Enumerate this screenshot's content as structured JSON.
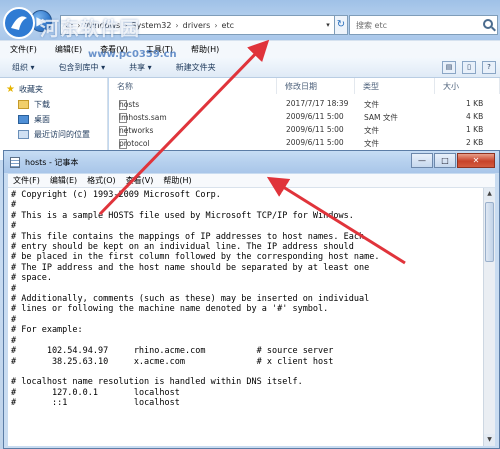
{
  "explorer": {
    "address": {
      "crumbs": [
        "C:",
        "Windows",
        "System32",
        "drivers",
        "etc"
      ],
      "dropdown_glyph": "▾",
      "refresh_glyph": "↻"
    },
    "search": {
      "placeholder": "搜索 etc"
    },
    "menu": [
      "文件(F)",
      "编辑(E)",
      "查看(V)",
      "工具(T)",
      "帮助(H)"
    ],
    "toolbar": {
      "organize": "组织 ▾",
      "include": "包含到库中 ▾",
      "share": "共享 ▾",
      "new_folder": "新建文件夹"
    },
    "nav_pane": {
      "favorites": "收藏夹",
      "items": [
        "下载",
        "桌面",
        "最近访问的位置"
      ]
    },
    "columns": {
      "name": "名称",
      "modified": "修改日期",
      "type": "类型",
      "size": "大小"
    },
    "files": [
      {
        "name": "hosts",
        "modified": "2017/7/17 18:39",
        "type": "文件",
        "size": "1 KB"
      },
      {
        "name": "lmhosts.sam",
        "modified": "2009/6/11 5:00",
        "type": "SAM 文件",
        "size": "4 KB"
      },
      {
        "name": "networks",
        "modified": "2009/6/11 5:00",
        "type": "文件",
        "size": "1 KB"
      },
      {
        "name": "protocol",
        "modified": "2009/6/11 5:00",
        "type": "文件",
        "size": "2 KB"
      }
    ]
  },
  "notepad": {
    "title": "hosts - 记事本",
    "controls": {
      "minimize": "—",
      "maximize": "□",
      "close": "✕"
    },
    "menu": [
      "文件(F)",
      "编辑(E)",
      "格式(O)",
      "查看(V)",
      "帮助(H)"
    ],
    "content": "# Copyright (c) 1993-2009 Microsoft Corp.\n#\n# This is a sample HOSTS file used by Microsoft TCP/IP for Windows.\n#\n# This file contains the mappings of IP addresses to host names. Each\n# entry should be kept on an individual line. The IP address should\n# be placed in the first column followed by the corresponding host name.\n# The IP address and the host name should be separated by at least one\n# space.\n#\n# Additionally, comments (such as these) may be inserted on individual\n# lines or following the machine name denoted by a '#' symbol.\n#\n# For example:\n#\n#      102.54.94.97     rhino.acme.com          # source server\n#       38.25.63.10     x.acme.com              # x client host\n\n# localhost name resolution is handled within DNS itself.\n#\t127.0.0.1       localhost\n#\t::1             localhost"
  },
  "watermark": {
    "site_name": "河东软件园",
    "url": "www.pc0359.cn"
  },
  "colors": {
    "annotation_arrow": "#e0343b",
    "titlebar": "#b6d0ee",
    "close_button": "#c7432a"
  }
}
